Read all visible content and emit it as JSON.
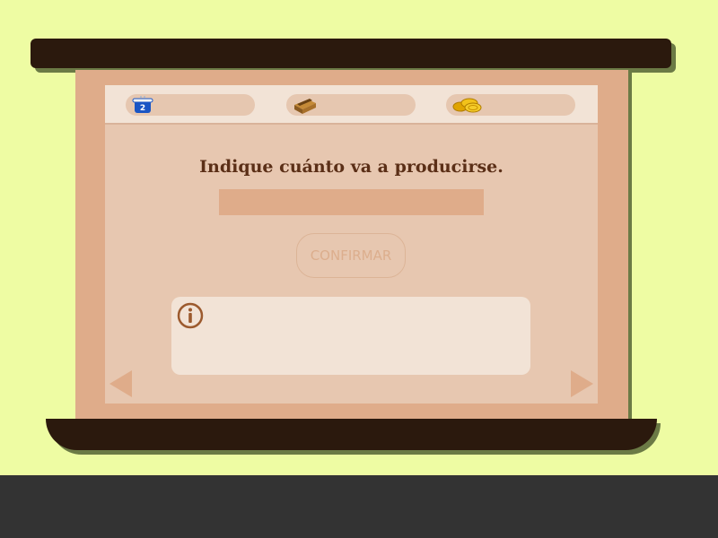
{
  "resources": {
    "pot_level": "2",
    "pot_value": "",
    "wood_value": "",
    "gold_value": ""
  },
  "question": {
    "prompt": "Indique cuánto va a producirse.",
    "answer_value": "",
    "confirm_label": "CONFIRMAR"
  },
  "info": {
    "icon": "info-icon",
    "message": ""
  },
  "navigation": {
    "previous_icon": "triangle-left-icon",
    "next_icon": "triangle-right-icon"
  },
  "colors": {
    "background": "#eefca3",
    "frame_dark": "#2b190d",
    "board": "#dfac8a",
    "screen": "#e7c7b0",
    "panel": "#f2e3d6",
    "text": "#5b2f17",
    "footer": "#333333"
  }
}
